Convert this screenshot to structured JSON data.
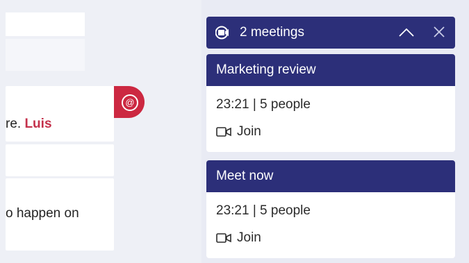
{
  "chat": {
    "message_one_text": "re. ",
    "message_one_mention": "Luis",
    "message_two_text": "o happen on",
    "mention_badge_symbol": "@"
  },
  "meetings_panel": {
    "icon": "video-camera-icon",
    "title": "2 meetings",
    "collapse_icon": "chevron-up-icon",
    "close_icon": "close-icon",
    "header_color": "#2c2f79",
    "items": [
      {
        "title": "Marketing review",
        "info": "23:21 | 5 people",
        "join_icon": "video-camera-icon",
        "join_label": "Join"
      },
      {
        "title": "Meet now",
        "info": "23:21 | 5 people",
        "join_icon": "video-camera-icon",
        "join_label": "Join"
      }
    ]
  }
}
